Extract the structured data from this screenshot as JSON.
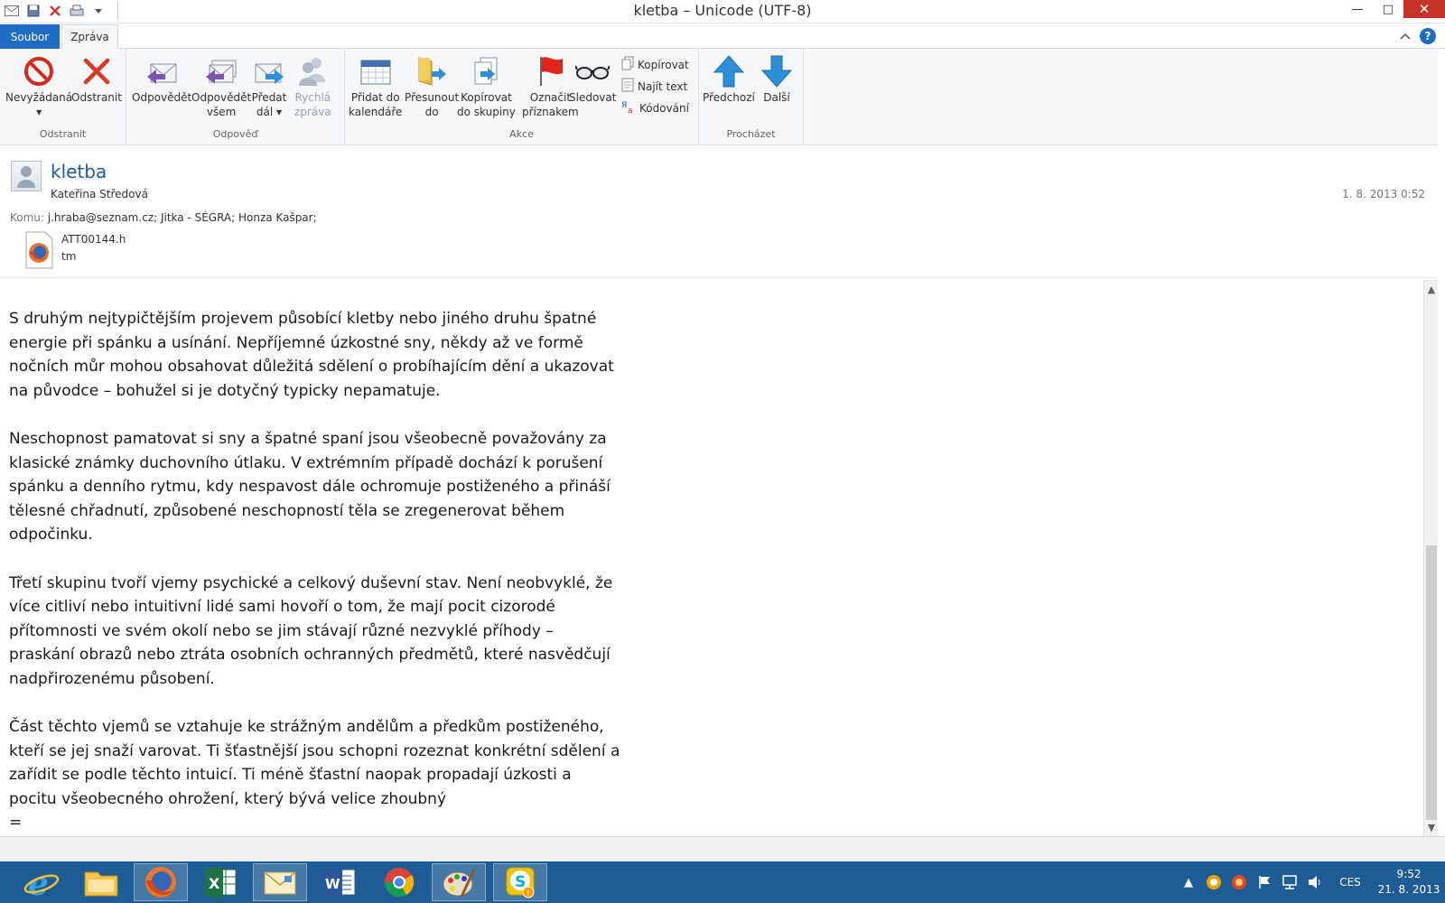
{
  "window": {
    "title": "kletba – Unicode (UTF-8)",
    "minimize": "—",
    "maximize": "□",
    "close": "✕"
  },
  "ribbon_tabs": {
    "file": "Soubor",
    "message": "Zpráva"
  },
  "ribbon": {
    "groups": {
      "remove": "Odstranit",
      "respond": "Odpověď",
      "actions": "Akce",
      "browse": "Procházet"
    },
    "buttons": {
      "junk": "Nevyžádaná",
      "delete": "Odstranit",
      "reply": "Odpovědět",
      "reply_all_1": "Odpovědět",
      "reply_all_2": "všem",
      "forward_1": "Předat",
      "forward_2": "dál",
      "quick_1": "Rychlá",
      "quick_2": "zpráva",
      "calendar_1": "Přidat do",
      "calendar_2": "kalendáře",
      "move_1": "Přesunout",
      "move_2": "do",
      "copy_group_1": "Kopírovat",
      "copy_group_2": "do skupiny",
      "flag_1": "Označit",
      "flag_2": "příznakem",
      "watch": "Sledovat",
      "copy": "Kopírovat",
      "find_text": "Najít text",
      "encoding": "Kódování",
      "previous": "Předchozí",
      "next": "Další"
    }
  },
  "message": {
    "subject": "kletba",
    "sender": "Kateřina Středová",
    "date": "1. 8. 2013 0:52",
    "to_label": "Komu:",
    "to": "j.hraba@seznam.cz; Jitka - SÉGRA; Honza Kašpar;",
    "attachment": {
      "name_line1": "ATT00144.h",
      "name_line2": "tm"
    },
    "body": [
      "S druhým nejtypičtějším projevem působící kletby nebo jiného druhu špatné energie při spánku a usínání. Nepříjemné úzkostné sny, někdy až ve formě nočních můr mohou obsahovat důležitá sdělení o probíhajícím dění a ukazovat na původce – bohužel si je dotyčný typicky nepamatuje.",
      "Neschopnost pamatovat si sny a špatné spaní jsou všeobecně považovány za klasické známky duchovního útlaku. V extrémním případě dochází k porušení spánku a denního rytmu, kdy nespavost dále ochromuje postiženého a přináší tělesné chřadnutí, způsobené neschopností těla se zregenerovat během odpočinku.",
      "Třetí skupinu tvoří vjemy psychické a celkový duševní stav. Není neobvyklé, že více citliví nebo intuitivní lidé sami hovoří o tom, že mají pocit cizorodé přítomnosti ve svém okolí nebo se jim stávají různé nezvyklé příhody – praskání obrazů nebo ztráta osobních ochranných předmětů, které nasvědčují nadpřirozenému působení.",
      "Část těchto vjemů se vztahuje ke strážným andělům a předkům postiženého, kteří se jej snaží varovat. Ti šťastnější jsou schopni rozeznat konkrétní sdělení a zařídit se podle těchto intuicí. Ti méně šťastní naopak propadají úzkosti a pocitu všeobecného ohrožení, který bývá velice zhoubný",
      "="
    ]
  },
  "taskbar": {
    "language": "CES",
    "time": "9:52",
    "date": "21. 8. 2013"
  },
  "colors": {
    "accent": "#1e6cc4",
    "taskbar": "#1d5c94",
    "close": "#c7332b"
  }
}
